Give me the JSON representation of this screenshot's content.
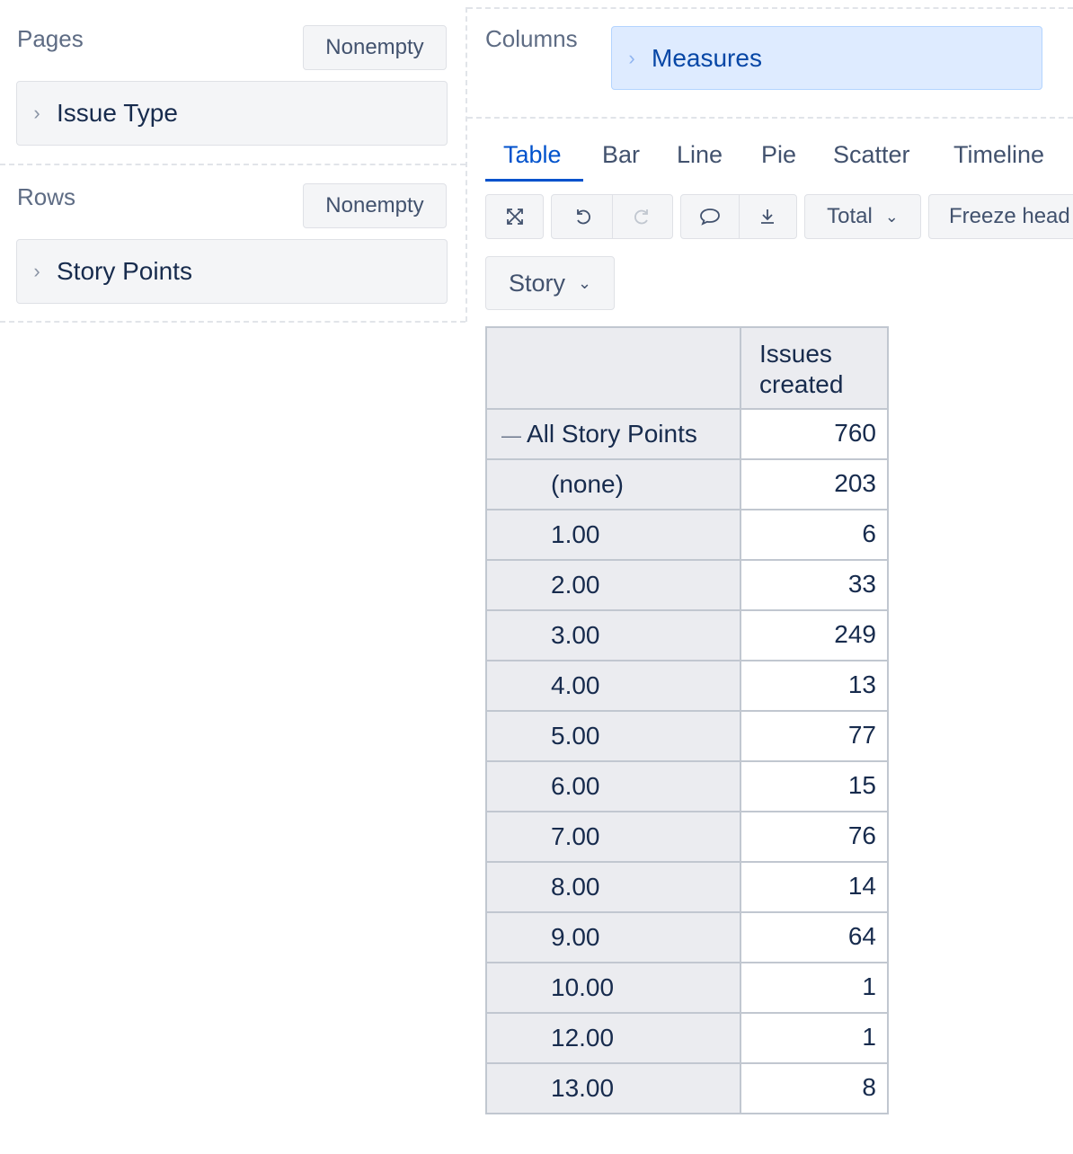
{
  "pages": {
    "label": "Pages",
    "nonempty_label": "Nonempty",
    "dimension": "Issue Type"
  },
  "rows": {
    "label": "Rows",
    "nonempty_label": "Nonempty",
    "dimension": "Story Points"
  },
  "columns": {
    "label": "Columns",
    "dimension": "Measures"
  },
  "tabs": [
    "Table",
    "Bar",
    "Line",
    "Pie",
    "Scatter",
    "Timeline"
  ],
  "active_tab": "Table",
  "toolbar": {
    "total_label": "Total",
    "freeze_label": "Freeze head",
    "story_label": "Story"
  },
  "table": {
    "column_header": "Issues created",
    "rows": [
      {
        "label": "All Story Points",
        "value": "760",
        "expand": "—"
      },
      {
        "label": "(none)",
        "value": "203"
      },
      {
        "label": "1.00",
        "value": "6"
      },
      {
        "label": "2.00",
        "value": "33"
      },
      {
        "label": "3.00",
        "value": "249"
      },
      {
        "label": "4.00",
        "value": "13"
      },
      {
        "label": "5.00",
        "value": "77"
      },
      {
        "label": "6.00",
        "value": "15"
      },
      {
        "label": "7.00",
        "value": "76"
      },
      {
        "label": "8.00",
        "value": "14"
      },
      {
        "label": "9.00",
        "value": "64"
      },
      {
        "label": "10.00",
        "value": "1"
      },
      {
        "label": "12.00",
        "value": "1"
      },
      {
        "label": "13.00",
        "value": "8"
      }
    ]
  },
  "icons": {
    "expand": "fullscreen-icon",
    "undo": "undo-icon",
    "redo": "redo-icon",
    "comment": "comment-icon",
    "download": "download-icon",
    "chevron": "chevron-right-icon"
  },
  "colors": {
    "accent": "#0052cc",
    "measure_bg": "#deebff",
    "header_bg": "#ebecf0"
  }
}
